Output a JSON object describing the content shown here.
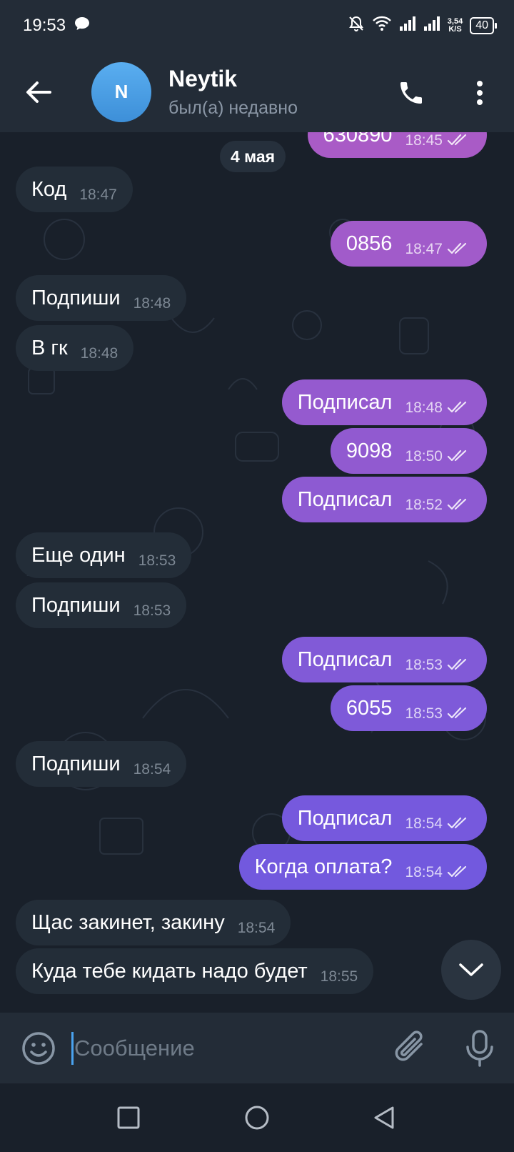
{
  "status_bar": {
    "time": "19:53",
    "net_speed_value": "3,54",
    "net_speed_unit": "K/S",
    "battery": "40"
  },
  "header": {
    "avatar_letter": "N",
    "contact_name": "Neytik",
    "contact_status": "был(а) недавно"
  },
  "chat": {
    "date_chip": "4 мая",
    "messages": [
      {
        "dir": "out",
        "text": "630890",
        "time": "18:45"
      },
      {
        "dir": "in",
        "text": "Код",
        "time": "18:47"
      },
      {
        "dir": "out",
        "text": "0856",
        "time": "18:47"
      },
      {
        "dir": "in",
        "text": "Подпиши",
        "time": "18:48"
      },
      {
        "dir": "in",
        "text": "В гк",
        "time": "18:48"
      },
      {
        "dir": "out",
        "text": "Подписал",
        "time": "18:48"
      },
      {
        "dir": "out",
        "text": "9098",
        "time": "18:50"
      },
      {
        "dir": "out",
        "text": "Подписал",
        "time": "18:52"
      },
      {
        "dir": "in",
        "text": "Еще один",
        "time": "18:53"
      },
      {
        "dir": "in",
        "text": "Подпиши",
        "time": "18:53"
      },
      {
        "dir": "out",
        "text": "Подписал",
        "time": "18:53"
      },
      {
        "dir": "out",
        "text": "6055",
        "time": "18:53"
      },
      {
        "dir": "in",
        "text": "Подпиши",
        "time": "18:54"
      },
      {
        "dir": "out",
        "text": "Подписал",
        "time": "18:54"
      },
      {
        "dir": "out",
        "text": "Когда оплата?",
        "time": "18:54"
      },
      {
        "dir": "in",
        "text": "Щас закинет, закину",
        "time": "18:54"
      },
      {
        "dir": "in",
        "text": "Куда тебе кидать надо будет",
        "time": "18:55"
      }
    ]
  },
  "input": {
    "placeholder": "Сообщение"
  },
  "icons": {
    "back": "arrow-left-icon",
    "call": "phone-icon",
    "menu": "more-vertical-icon",
    "emoji": "smile-icon",
    "attach": "paperclip-icon",
    "mic": "microphone-icon",
    "scroll": "chevron-down-icon",
    "nav_recent": "square-icon",
    "nav_home": "circle-icon",
    "nav_back": "triangle-back-icon"
  },
  "colors": {
    "header_bg": "#232c37",
    "chat_bg": "#19202a",
    "incoming_bubble": "#232d38",
    "outgoing_top": "#a259c9",
    "outgoing_bottom": "#6a5be0",
    "accent": "#4aa3f0"
  }
}
